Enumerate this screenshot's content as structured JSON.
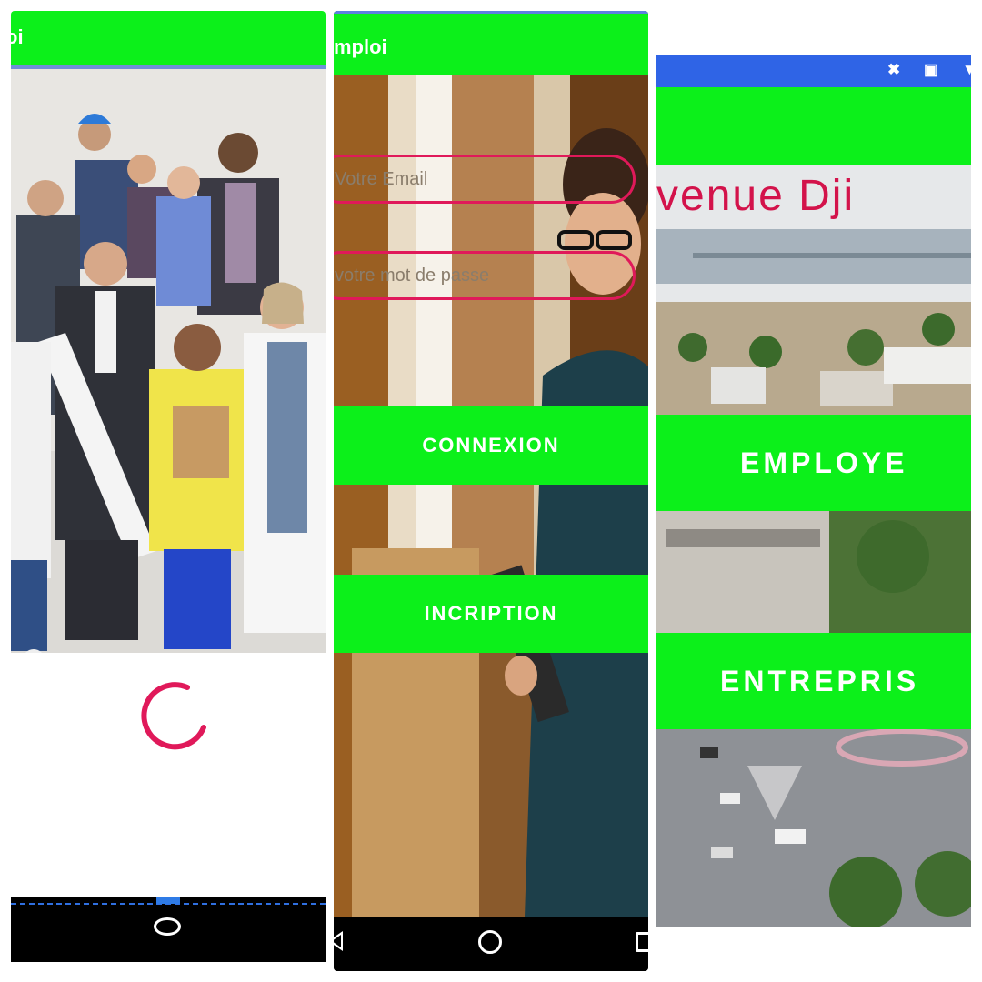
{
  "colors": {
    "accent_green": "#0cf01a",
    "status_blue": "#2f64e6",
    "input_border": "#e0195a",
    "spinner_red": "#e0195a"
  },
  "screen1": {
    "app_title": "oi",
    "loading": true,
    "icons": [
      "spinner-icon",
      "home-icon"
    ]
  },
  "screen2": {
    "app_title": "mploi",
    "email_placeholder": "Votre Email",
    "password_placeholder": "votre mot de passe",
    "connexion_label": "CONNEXION",
    "inscription_label": "INCRIPTION",
    "icons": [
      "back-icon",
      "home-icon",
      "recents-icon"
    ]
  },
  "screen3": {
    "headline": "venue Dji",
    "employe_label": "EMPLOYE",
    "entreprise_label": "ENTREPRIS",
    "status_icons": [
      "cast-icon",
      "image-icon",
      "signal-icon"
    ]
  }
}
